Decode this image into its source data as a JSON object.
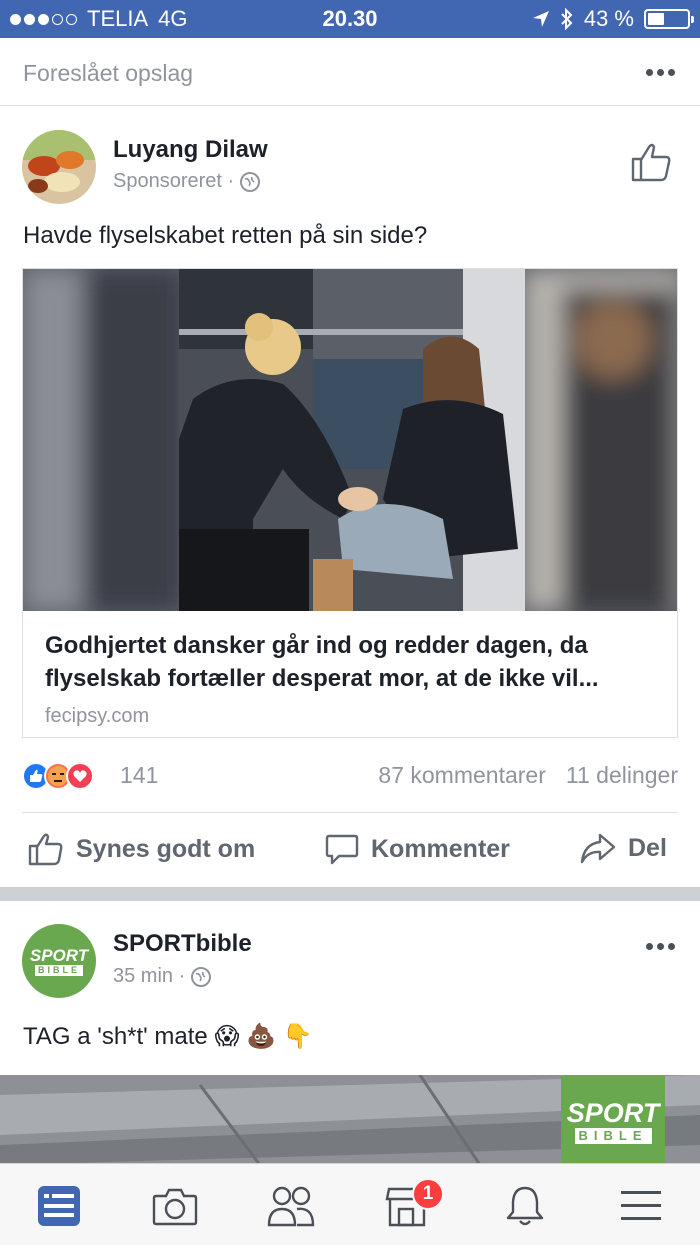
{
  "status_bar": {
    "carrier": "TELIA",
    "network": "4G",
    "time": "20.30",
    "battery": "43 %",
    "battery_level": 0.43
  },
  "suggested_header": {
    "label": "Foreslået opslag",
    "more_icon": "ellipsis-icon"
  },
  "post1": {
    "author": "Luyang Dilaw",
    "meta": "Sponsoreret ·",
    "text": "Havde flyselskabet retten på sin side?",
    "link": {
      "title": "Godhjertet dansker går ind og redder dagen, da flyselskab fortæller desperat mor, at de ikke vil...",
      "domain": "fecipsy.com"
    },
    "reactions_count": "141",
    "comments": "87 kommentarer",
    "shares": "11 delinger",
    "actions": {
      "like": "Synes godt om",
      "comment": "Kommenter",
      "share": "Del"
    }
  },
  "post2": {
    "author": "SPORTbible",
    "meta": "35 min ·",
    "text": "TAG a 'sh*t' mate 😱 💩 👇",
    "avatar_text_top": "SPORT",
    "avatar_text_bottom": "BIBLE",
    "logo_text_top": "SPORT",
    "logo_text_bottom": "BIBLE"
  },
  "tabbar": {
    "tabs": [
      "news-feed-icon",
      "camera-icon",
      "friends-icon",
      "marketplace-icon",
      "bell-icon",
      "menu-icon"
    ],
    "marketplace_badge": "1"
  },
  "colors": {
    "brand": "#4267b2",
    "like_blue": "#2078f4",
    "sport_green": "#6aa84f"
  }
}
